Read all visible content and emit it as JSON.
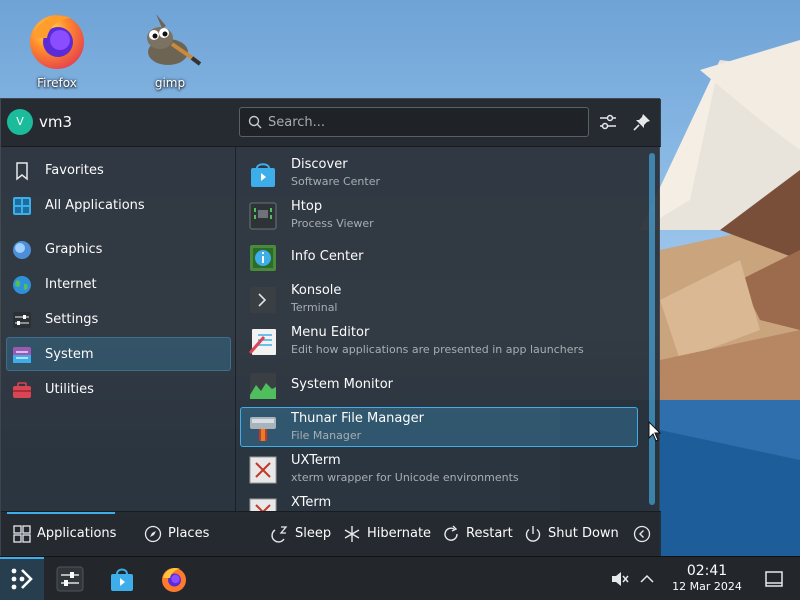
{
  "desktop": {
    "icons": [
      {
        "label": "Firefox",
        "icon": "firefox-icon"
      },
      {
        "label": "gimp",
        "icon": "gimp-icon"
      }
    ]
  },
  "launcher": {
    "user": {
      "initial": "V",
      "name": "vm3"
    },
    "search": {
      "placeholder": "Search..."
    },
    "header_buttons": [
      "configure-icon",
      "pin-icon"
    ],
    "sidebar": {
      "items": [
        {
          "label": "Favorites",
          "icon": "bookmark-icon",
          "active": false
        },
        {
          "label": "All Applications",
          "icon": "grid-icon",
          "active": false
        },
        {
          "label": "Graphics",
          "icon": "graphics-icon",
          "active": false
        },
        {
          "label": "Internet",
          "icon": "globe-icon",
          "active": false
        },
        {
          "label": "Settings",
          "icon": "settings-sliders-icon",
          "active": false
        },
        {
          "label": "System",
          "icon": "system-icon",
          "active": true
        },
        {
          "label": "Utilities",
          "icon": "toolbox-icon",
          "active": false
        }
      ]
    },
    "apps": [
      {
        "name": "Discover",
        "desc": "Software Center",
        "icon": "discover-icon",
        "hover": false
      },
      {
        "name": "Htop",
        "desc": "Process Viewer",
        "icon": "htop-icon",
        "hover": false
      },
      {
        "name": "Info Center",
        "desc": "",
        "icon": "info-center-icon",
        "hover": false
      },
      {
        "name": "Konsole",
        "desc": "Terminal",
        "icon": "konsole-icon",
        "hover": false
      },
      {
        "name": "Menu Editor",
        "desc": "Edit how applications are presented in app launchers",
        "icon": "menu-editor-icon",
        "hover": false
      },
      {
        "name": "System Monitor",
        "desc": "",
        "icon": "system-monitor-icon",
        "hover": false
      },
      {
        "name": "Thunar File Manager",
        "desc": "File Manager",
        "icon": "thunar-icon",
        "hover": true
      },
      {
        "name": "UXTerm",
        "desc": "xterm wrapper for Unicode environments",
        "icon": "uxterm-icon",
        "hover": false
      },
      {
        "name": "XTerm",
        "desc": "",
        "icon": "xterm-icon",
        "hover": false
      }
    ],
    "footer": {
      "tabs": [
        {
          "label": "Applications",
          "icon": "grid-icon",
          "active": true
        },
        {
          "label": "Places",
          "icon": "compass-icon",
          "active": false
        }
      ],
      "power": [
        {
          "label": "Sleep",
          "icon": "sleep-icon"
        },
        {
          "label": "Hibernate",
          "icon": "hibernate-icon"
        },
        {
          "label": "Restart",
          "icon": "restart-icon"
        },
        {
          "label": "Shut Down",
          "icon": "power-icon"
        }
      ],
      "more_icon": "chevron-left-icon"
    }
  },
  "taskbar": {
    "launchers": [
      "application-launcher-icon",
      "system-settings-icon",
      "discover-icon",
      "firefox-icon"
    ],
    "tray": [
      "volume-muted-icon",
      "chevron-up-icon"
    ],
    "clock": {
      "time": "02:41",
      "date": "12 Mar 2024"
    },
    "show_desktop_icon": "show-desktop-icon"
  }
}
